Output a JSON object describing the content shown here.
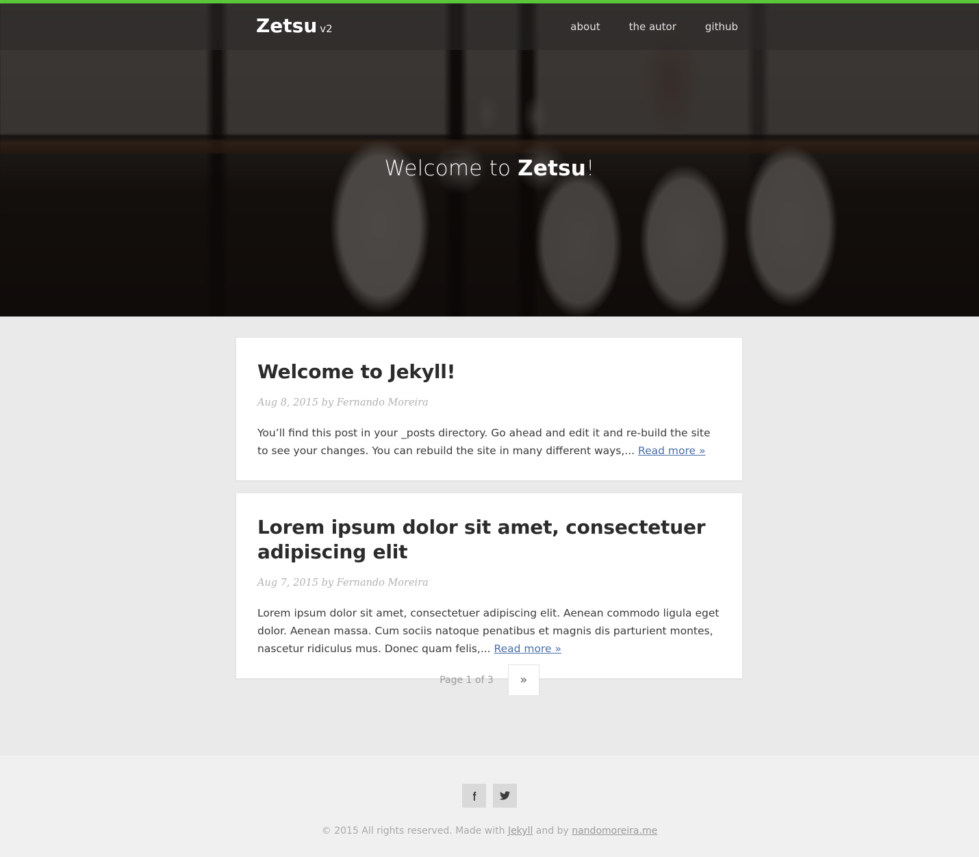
{
  "theme": {
    "accent_green": "#5ac63a",
    "content_bg": "#eaeaea",
    "footer_bg": "#f0f0f0",
    "link_blue": "#4a6ea9",
    "card_bg": "#ffffff",
    "text_dark": "#333333"
  },
  "header": {
    "logo_name": "Zetsu",
    "logo_version": "v2",
    "nav": [
      {
        "label": "about",
        "name": "nav-item-about"
      },
      {
        "label": "the autor",
        "name": "nav-item-the-autor"
      },
      {
        "label": "github",
        "name": "nav-item-github"
      }
    ]
  },
  "hero": {
    "title_prefix": "Welcome to ",
    "title_strong": "Zetsu",
    "title_suffix": "!",
    "background_description": "dark dining room with white chairs and wooden table"
  },
  "posts": [
    {
      "title": "Welcome to Jekyll!",
      "meta": "Aug 8, 2015 by Fernando Moreira",
      "excerpt": "You’ll find this post in your _posts directory. Go ahead and edit it and re-build the site to see your changes. You can rebuild the site in many different ways,... ",
      "read_more": "Read more »"
    },
    {
      "title": "Lorem ipsum dolor sit amet, consectetuer adipiscing elit",
      "meta": "Aug 7, 2015 by Fernando Moreira",
      "excerpt": "Lorem ipsum dolor sit amet, consectetuer adipiscing elit. Aenean commodo ligula eget dolor. Aenean massa. Cum sociis natoque penatibus et magnis dis parturient montes, nascetur ridiculus mus. Donec quam felis,... ",
      "read_more": "Read more »"
    }
  ],
  "pagination": {
    "page_label": "Page 1 of 3",
    "next_label": "»",
    "current_page": 1,
    "total_pages": 3
  },
  "footer": {
    "social": [
      {
        "icon": "facebook-icon",
        "name": "social-link-facebook"
      },
      {
        "icon": "twitter-icon",
        "name": "social-link-twitter"
      }
    ],
    "copyright_part1": "© 2015 All rights reserved. Made with ",
    "copyright_link1": "Jekyll",
    "copyright_part2": " and by ",
    "copyright_link2": "nandomoreira.me"
  }
}
